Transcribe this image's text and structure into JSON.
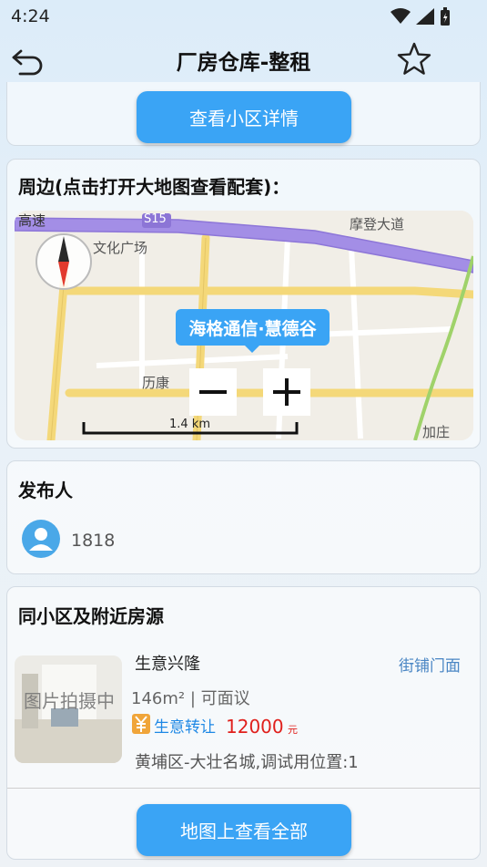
{
  "status_bar": {
    "time": "4:24"
  },
  "header": {
    "title": "厂房仓库-整租"
  },
  "community_card": {
    "button_label": "查看小区详情"
  },
  "map_card": {
    "title": "周边(点击打开大地图查看配套)：",
    "tooltip": "海格通信·慧德谷",
    "scale_label": "1.4 km",
    "labels": {
      "highway_left": "高速",
      "route": "S15",
      "place_culture": "文化广场",
      "place_modeng": "摩登大道",
      "place_likang": "历康",
      "place_jiazhuang": "加庄"
    }
  },
  "publisher_card": {
    "title": "发布人",
    "name": "1818"
  },
  "nearby_card": {
    "title": "同小区及附近房源",
    "listing": {
      "thumb_caption": "图片拍摄中",
      "name": "生意兴隆",
      "category": "街铺门面",
      "area_info": "146m² | 可面议",
      "tag": "生意转让",
      "price": "12000",
      "price_unit": "元",
      "address": "黄埔区-大壮名城,调试用位置:1"
    },
    "button_label": "地图上查看全部"
  },
  "colors": {
    "accent": "#3aa4f5",
    "price": "#e0201c",
    "tag": "#1e88e5"
  }
}
